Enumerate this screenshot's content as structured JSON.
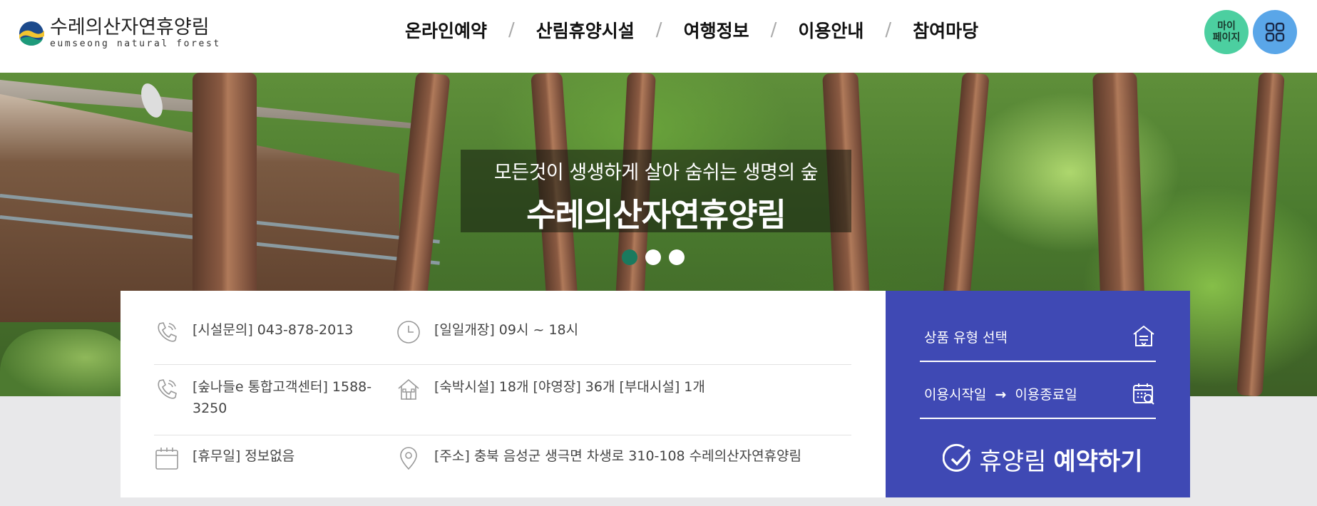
{
  "header": {
    "logo": {
      "name_ko": "수레의산자연휴양림",
      "name_en": "eumseong natural forest"
    },
    "nav": [
      {
        "label": "온라인예약"
      },
      {
        "label": "산림휴양시설"
      },
      {
        "label": "여행정보"
      },
      {
        "label": "이용안내"
      },
      {
        "label": "참여마당"
      }
    ],
    "mypage": {
      "line1": "마이",
      "line2": "페이지"
    }
  },
  "hero": {
    "subtitle": "모든것이 생생하게 살아 숨쉬는 생명의 숲",
    "title": "수레의산자연휴양림",
    "slides": 3,
    "active_slide": 1
  },
  "info": {
    "facility_phone": "[시설문의] 043-878-2013",
    "hours": "[일일개장] 09시 ~ 18시",
    "callcenter_line1": "[숲나들e 통합고객센터] 1588-",
    "callcenter_line2": "3250",
    "lodging": "[숙박시설] 18개 [야영장] 36개 [부대시설] 1개",
    "closed": "[휴무일] 정보없음",
    "address": "[주소] 충북 음성군 생극면 차생로 310-108 수레의산자연휴양림"
  },
  "reservation": {
    "product_type": "상품 유형 선택",
    "start_date": "이용시작일",
    "arrow": "→",
    "end_date": "이용종료일",
    "button_light": "휴양림",
    "button_bold": "예약하기"
  },
  "colors": {
    "reservation_bg": "#3f49b4",
    "mypage_bg": "#4ccfa0",
    "menu_bg": "#5aa6e8",
    "active_dot": "#1a7a5e"
  }
}
